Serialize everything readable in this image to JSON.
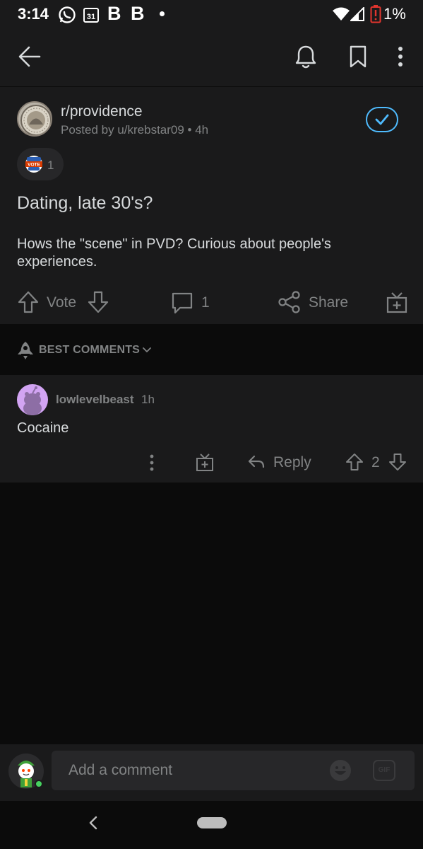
{
  "status_bar": {
    "time": "3:14",
    "calendar_day": "31",
    "battery_percent": "1%",
    "icons": [
      "whatsapp-icon",
      "calendar-icon",
      "b-app-icon",
      "b-app-icon",
      "notification-dot",
      "wifi-icon",
      "signal-icon",
      "battery-low-icon"
    ]
  },
  "toolbar": {
    "icons": [
      "back-arrow-icon",
      "bell-icon",
      "bookmark-icon",
      "more-vertical-icon"
    ]
  },
  "post": {
    "subreddit": "r/providence",
    "meta": "Posted by u/krebstar09 • 4h",
    "award_count": "1",
    "title": "Dating, late 30's?",
    "body": "Hows the \"scene\" in PVD? Curious about people's experiences.",
    "vote_label": "Vote",
    "comment_count": "1",
    "share_label": "Share"
  },
  "sort": {
    "label": "BEST COMMENTS"
  },
  "comment": {
    "username": "lowlevelbeast",
    "time": "1h",
    "body": "Cocaine",
    "reply_label": "Reply",
    "score": "2"
  },
  "composer": {
    "placeholder": "Add a comment",
    "gif_label": "GIF"
  },
  "colors": {
    "background": "#0b0b0b",
    "surface": "#1a1a1b",
    "text": "#d7dadc",
    "muted": "#818384",
    "accent": "#4fbcff",
    "online": "#46d160"
  }
}
